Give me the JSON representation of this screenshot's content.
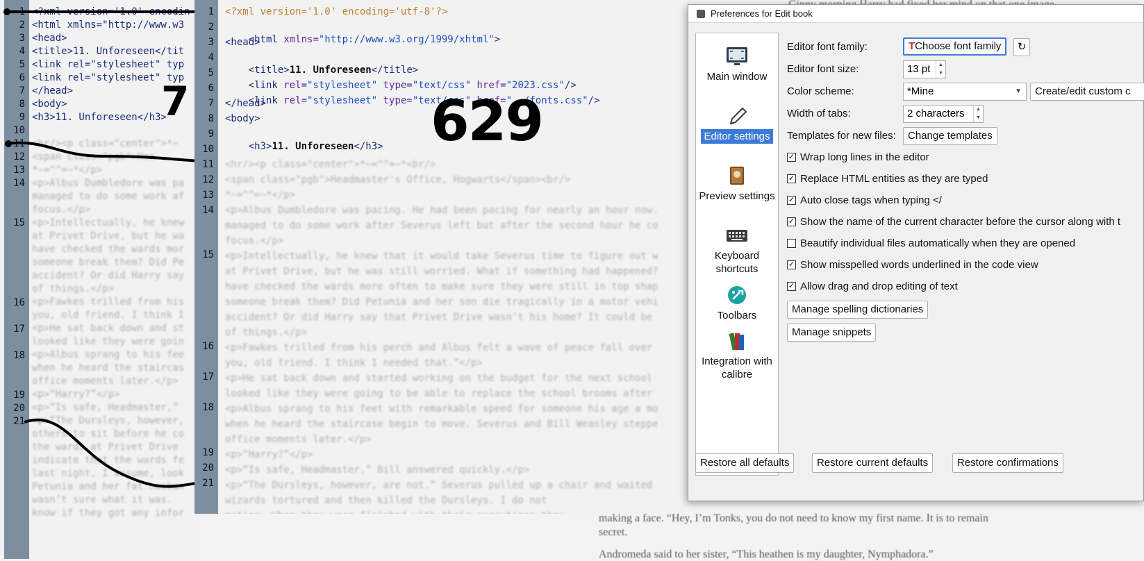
{
  "dialog": {
    "title": "Preferences for Edit book",
    "nav": [
      {
        "label": "Main window",
        "icon": "monitor-icon"
      },
      {
        "label": "Editor settings",
        "icon": "pen-icon"
      },
      {
        "label": "Preview settings",
        "icon": "book-icon"
      },
      {
        "label": "Keyboard shortcuts",
        "icon": "keyboard-icon"
      },
      {
        "label": "Toolbars",
        "icon": "toolbar-icon"
      },
      {
        "label": "Integration with calibre",
        "icon": "books-icon"
      }
    ],
    "font_family_label": "Editor font family:",
    "font_family_button": "Choose font family",
    "font_size_label": "Editor font size:",
    "font_size_value": "13 pt",
    "color_scheme_label": "Color scheme:",
    "color_scheme_value": "*Mine",
    "color_scheme_button": "Create/edit custom c",
    "tab_width_label": "Width of tabs:",
    "tab_width_value": "2 characters",
    "templates_label": "Templates for new files:",
    "templates_button": "Change templates",
    "checkboxes": [
      {
        "label": "Wrap long lines in the editor",
        "checked": true
      },
      {
        "label": "Replace HTML entities as they are typed",
        "checked": true
      },
      {
        "label": "Auto close tags when typing </",
        "checked": true
      },
      {
        "label": "Show the name of the current character before the cursor along with t",
        "checked": true
      },
      {
        "label": "Beautify individual files automatically when they are opened",
        "checked": false
      },
      {
        "label": "Show misspelled words underlined in the code view",
        "checked": true
      },
      {
        "label": "Allow drag and drop editing of text",
        "checked": true
      }
    ],
    "spelling_button": "Manage spelling dictionaries",
    "snippets_button": "Manage snippets",
    "footer": {
      "restore_all": "Restore all defaults",
      "restore_current": "Restore current defaults",
      "restore_confirm": "Restore confirmations"
    }
  },
  "annotations": {
    "left_number": "7",
    "front_number": "629"
  },
  "back_editor": {
    "line_numbers": [
      "1",
      "2",
      "3",
      "4",
      "5",
      "6",
      "7",
      "8",
      "9",
      "10",
      "11",
      "12",
      "13",
      "14",
      "15",
      "16",
      "17",
      "18",
      "19",
      "20",
      "21"
    ],
    "lines": [
      "<?xml version='1.0' encodin",
      "<html xmlns=\"http://www.w3",
      "<head>",
      "<title>11. Unforeseen</tit",
      "<link rel=\"stylesheet\" typ",
      "<link rel=\"stylesheet\" typ",
      "</head>",
      "<body>",
      "<h3>11. Unforeseen</h3>"
    ],
    "faded": [
      "<hr/><p class=\"center\">*~",
      "<span class=\"pgb\">Hea",
      "*~=^^=~*</p>",
      "<p>Albus Dumbledore was pa",
      "managed to do some work af",
      "focus.</p>",
      "<p>Intellectually, he knew",
      "at Privet Drive, but he wa",
      "have checked the wards mor",
      "someone break them? Did Pe",
      "accident? Or did Harry say",
      "of things.</p>",
      "<p>Fawkes trilled from his",
      "you, old friend. I think I",
      "<p>He sat back down and st",
      "looked like they were goin",
      "<p>Albus sprang to his fee",
      "when he heard the staircas",
      "office moments later.</p>",
      "<p>“Harry?”</p>",
      "<p>“Is safe, Headmaster,”",
      "<p>“The Dursleys, however,",
      "others to sit before he co",
      "the wards at Privet Drive",
      "indicate that the wards fe",
      "last night, I assume, look",
      "Petunia and her fat husban",
      "wasn’t sure what it was.",
      "know if they got any infor"
    ]
  },
  "front_editor": {
    "line_numbers": [
      "1",
      "2",
      "3",
      "4",
      "5",
      "6",
      "7",
      "8",
      "9",
      "10",
      "11",
      "12",
      "13",
      "14",
      "15",
      "16",
      "17",
      "18",
      "19",
      "20",
      "21"
    ],
    "l1": "<?xml version='1.0' encoding='utf-8'?>",
    "l2_tag": "<html ",
    "l2_attr": "xmlns=",
    "l2_str": "\"http://www.w3.org/1999/xhtml\"",
    "l2_end": ">",
    "l3": "<head>",
    "l4_open": "<title>",
    "l4_text": "11. Unforeseen",
    "l4_close": "</title>",
    "l5_tag": "<link ",
    "l5_attr1": "rel=",
    "l5_str1": "\"stylesheet\" ",
    "l5_attr2": "type=",
    "l5_str2": "\"text/css\" ",
    "l5_attr3": "href=",
    "l5_str3": "\"2023.css\"",
    "l5_end": "/>",
    "l6_tag": "<link ",
    "l6_attr1": "rel=",
    "l6_str1": "\"stylesheet\" ",
    "l6_attr2": "type=",
    "l6_str2": "\"text/css\" ",
    "l6_attr3": "href=",
    "l6_str3": "\"../fonts.css\"",
    "l6_end": "/>",
    "l7": "</head>",
    "l8": "<body>",
    "l9_open": "<h3>",
    "l9_text": "11. Unforeseen",
    "l9_close": "</h3>",
    "faded": [
      "<hr/><p class=\"center\">*~=^^=~*<br/>",
      "<span class=\"pgb\">Headmaster's Office, Hogwarts</span><br/>",
      "*~=^^=~*</p>",
      "<p>Albus Dumbledore was pacing. He had been pacing for nearly an hour now.",
      "managed to do some work after Severus left but after the second hour he co",
      "focus.</p>",
      "<p>Intellectually, he knew that it would take Severus time to figure out w",
      "at Privet Drive, but he was still worried. What if something had happened?",
      "have checked the wards more often to make sure they were still in top shap",
      "someone break them? Did Petunia and her son die tragically in a motor vehi",
      "accident? Or did Harry say that Privet Drive wasn't his home? It could be",
      "of things.</p>",
      "<p>Fawkes trilled from his perch and Albus felt a wave of peace fall over",
      "you, old friend. I think I needed that.”</p>",
      "<p>He sat back down and started working on the budget for the next school",
      "looked like they were going to be able to replace the school brooms after",
      "<p>Albus sprang to his feet with remarkable speed for someone his age a mo",
      "when he heard the staircase begin to move. Severus and Bill Weasley steppe",
      "office moments later.</p>",
      "<p>“Harry?”</p>",
      "<p>“Is safe, Headmaster,” Bill answered quickly.</p>",
      "<p>“The Dursleys, however, are not.” Severus pulled up a chair and waited",
      "wizards tortured and then killed the Dursleys. I do not",
      "mation. When they were finished with their executions they"
    ]
  },
  "background_page": {
    "lines": [
      "Ginny morning Harry had fixed her mind on that one image",
      "making a face. “Hey, I’m Tonks, you do not need to know my first name. It is to remain",
      "secret.",
      "Andromeda said to her sister, “This heathen is my daughter, Nymphadora.”"
    ]
  }
}
